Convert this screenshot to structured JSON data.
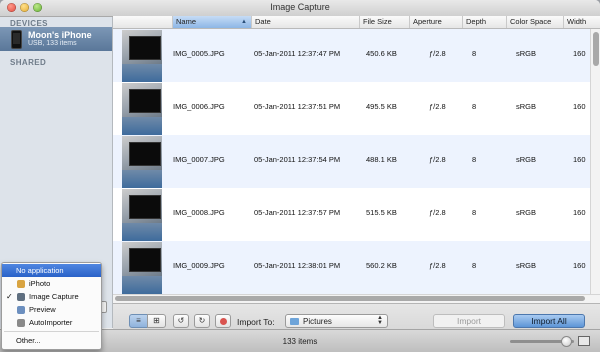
{
  "window": {
    "title": "Image Capture"
  },
  "sidebar": {
    "devices_heading": "DEVICES",
    "shared_heading": "SHARED",
    "device": {
      "name": "Moon's iPhone",
      "subtitle": "USB, 133 items"
    }
  },
  "table": {
    "columns": [
      "Name",
      "Date",
      "File Size",
      "Aperture",
      "Depth",
      "Color Space",
      "Width"
    ],
    "sorted_column": "Name",
    "rows": [
      {
        "name": "IMG_0005.JPG",
        "date": "05-Jan-2011 12:37:47 PM",
        "size": "450.6 KB",
        "aperture": "ƒ/2.8",
        "depth": "8",
        "color_space": "sRGB",
        "width": "160"
      },
      {
        "name": "IMG_0006.JPG",
        "date": "05-Jan-2011 12:37:51 PM",
        "size": "495.5 KB",
        "aperture": "ƒ/2.8",
        "depth": "8",
        "color_space": "sRGB",
        "width": "160"
      },
      {
        "name": "IMG_0007.JPG",
        "date": "05-Jan-2011 12:37:54 PM",
        "size": "488.1 KB",
        "aperture": "ƒ/2.8",
        "depth": "8",
        "color_space": "sRGB",
        "width": "160"
      },
      {
        "name": "IMG_0008.JPG",
        "date": "05-Jan-2011 12:37:57 PM",
        "size": "515.5 KB",
        "aperture": "ƒ/2.8",
        "depth": "8",
        "color_space": "sRGB",
        "width": "160"
      },
      {
        "name": "IMG_0009.JPG",
        "date": "05-Jan-2011 12:38:01 PM",
        "size": "560.2 KB",
        "aperture": "ƒ/2.8",
        "depth": "8",
        "color_space": "sRGB",
        "width": "160"
      }
    ]
  },
  "toolbar": {
    "import_to_label": "Import To:",
    "destination": "Pictures",
    "import_label": "Import",
    "import_all_label": "Import All",
    "icons": [
      "list-view-icon",
      "grid-view-icon",
      "rotate-left-icon",
      "rotate-right-icon",
      "delete-icon",
      "folder-icon"
    ]
  },
  "status": {
    "item_count": "133 items"
  },
  "app_menu": {
    "items": [
      {
        "label": "No application",
        "selected": true
      },
      {
        "label": "iPhoto"
      },
      {
        "label": "Image Capture",
        "checked": true
      },
      {
        "label": "Preview"
      },
      {
        "label": "AutoImporter"
      },
      {
        "label": "Other..."
      }
    ]
  },
  "colors": {
    "selection": "#2a62c8",
    "row_alt": "#edf3fe",
    "sidebar": "#dde3ea",
    "import_all": "#5d95d6"
  }
}
